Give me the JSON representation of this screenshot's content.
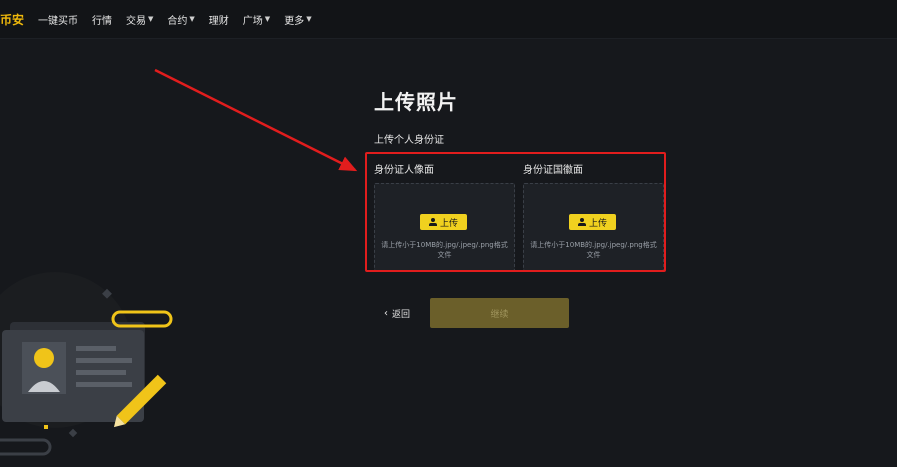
{
  "nav": {
    "brand": "币安",
    "items": [
      {
        "label": "一键买币",
        "has_caret": false
      },
      {
        "label": "行情",
        "has_caret": false
      },
      {
        "label": "交易",
        "has_caret": true
      },
      {
        "label": "合约",
        "has_caret": true
      },
      {
        "label": "理财",
        "has_caret": false
      },
      {
        "label": "广场",
        "has_caret": true
      },
      {
        "label": "更多",
        "has_caret": true
      }
    ]
  },
  "page": {
    "title": "上传照片",
    "section_label": "上传个人身份证"
  },
  "upload": {
    "front": {
      "label": "身份证人像面",
      "button": "上传",
      "hint": "请上传小于10MB的.jpg/.jpeg/.png格式文件"
    },
    "back": {
      "label": "身份证国徽面",
      "button": "上传",
      "hint": "请上传小于10MB的.jpg/.jpeg/.png格式文件"
    }
  },
  "actions": {
    "back_label": "返回",
    "continue_label": "继续"
  },
  "colors": {
    "brand": "#f0b90b",
    "annotation_red": "#e11d1d",
    "primary_yellow": "#f0d11f"
  }
}
